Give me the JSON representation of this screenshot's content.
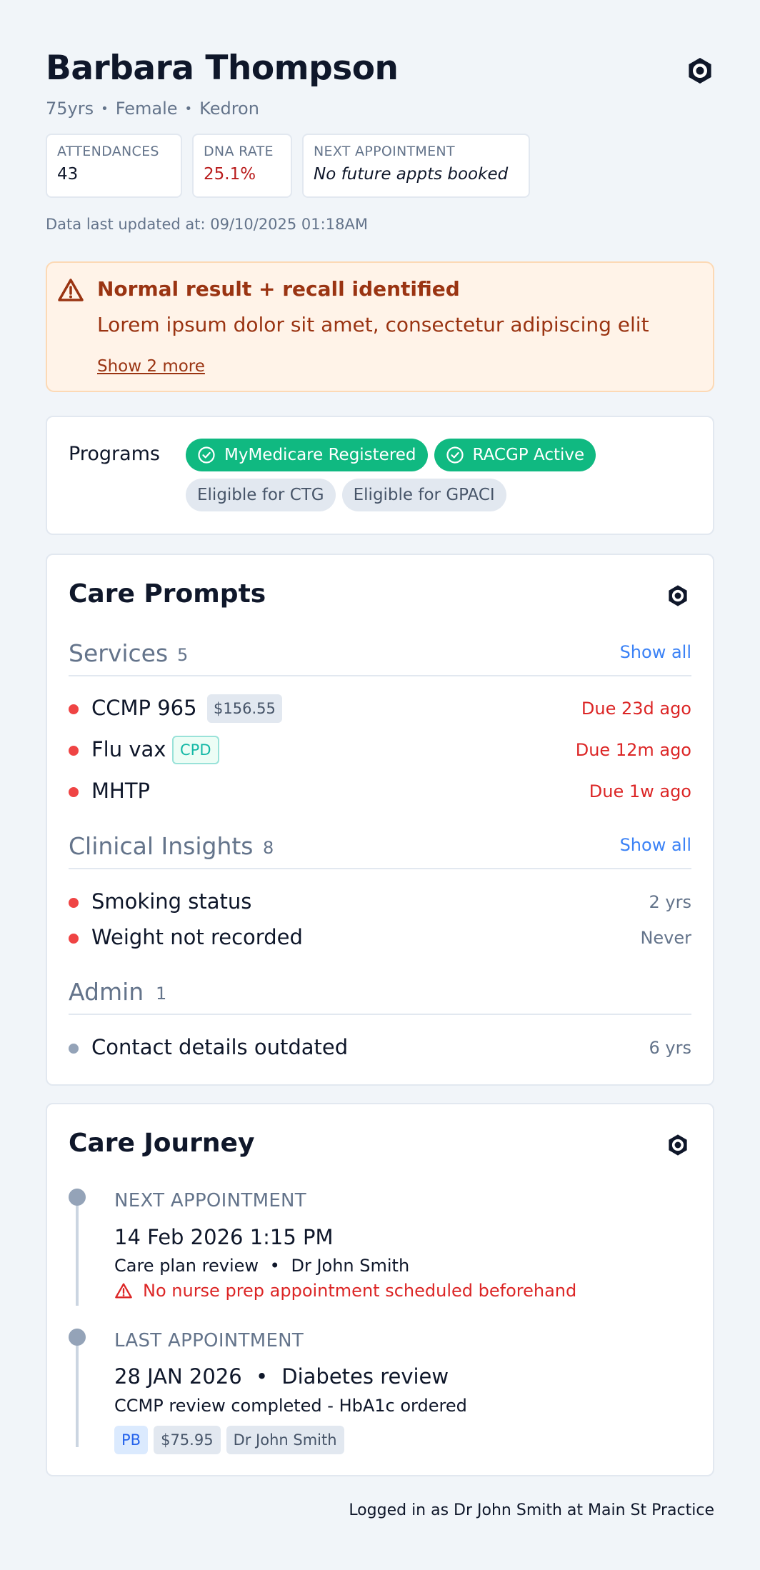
{
  "patient": {
    "name": "Barbara Thompson",
    "age": "75yrs",
    "sex": "Female",
    "suburb": "Kedron",
    "separator": "•"
  },
  "stats": [
    {
      "label": "ATTENDANCES",
      "value": "43"
    },
    {
      "label": "DNA RATE",
      "value": "25.1%",
      "color": "#b91c1c"
    },
    {
      "label": "NEXT APPOINTMENT",
      "value": "No future appts booked"
    }
  ],
  "updated": "Data last updated at: 09/10/2025 01:18AM",
  "alert": {
    "icon": "warning-icon",
    "title": "Normal result + recall identified",
    "body": "Lorem ipsum dolor sit amet, consectetur adipiscing elit",
    "more": "Show 2 more"
  },
  "programs": {
    "label": "Programs",
    "active": [
      "MyMedicare Registered",
      "RACGP Active"
    ],
    "eligible": [
      "Eligible for CTG",
      "Eligible for GPACI"
    ]
  },
  "care_prompts": {
    "title": "Care Prompts",
    "services": {
      "title": "Services",
      "count": "5",
      "show_all": "Show all",
      "items": [
        {
          "label": "CCMP 965",
          "tag": "$156.55",
          "due": "Due 23d ago"
        },
        {
          "label": "Flu vax",
          "tag": "CPD",
          "due": "Due 12m ago"
        },
        {
          "label": "MHTP",
          "due": "Due 1w ago"
        }
      ]
    },
    "insights": {
      "title": "Clinical Insights",
      "count": "8",
      "show_all": "Show all",
      "items": [
        {
          "label": "Smoking status",
          "value": "2 yrs"
        },
        {
          "label": "Weight not recorded",
          "value": "Never"
        }
      ]
    },
    "admin": {
      "title": "Admin",
      "count": "1",
      "items": [
        {
          "label": "Contact details outdated",
          "value": "6 yrs"
        }
      ]
    }
  },
  "care_journey": {
    "title": "Care Journey",
    "next": {
      "label": "NEXT APPOINTMENT",
      "datetime": "14 Feb 2026 1:15 PM",
      "type": "Care plan review",
      "sep": "•",
      "doctor": "Dr John Smith",
      "warning": "No nurse prep appointment scheduled beforehand"
    },
    "last": {
      "label": "LAST APPOINTMENT",
      "date": "28 JAN 2026",
      "sep": "•",
      "type": "Diabetes review",
      "note": "CCMP review completed - HbA1c ordered",
      "tags": [
        "PB",
        "$75.95",
        "Dr John Smith"
      ]
    }
  },
  "footer": "Logged in as Dr John Smith at Main St Practice",
  "colors": {
    "accent": "#3b82f6",
    "green": "#10b981",
    "danger": "#dc2626",
    "alert_bg": "#fff3e8"
  }
}
